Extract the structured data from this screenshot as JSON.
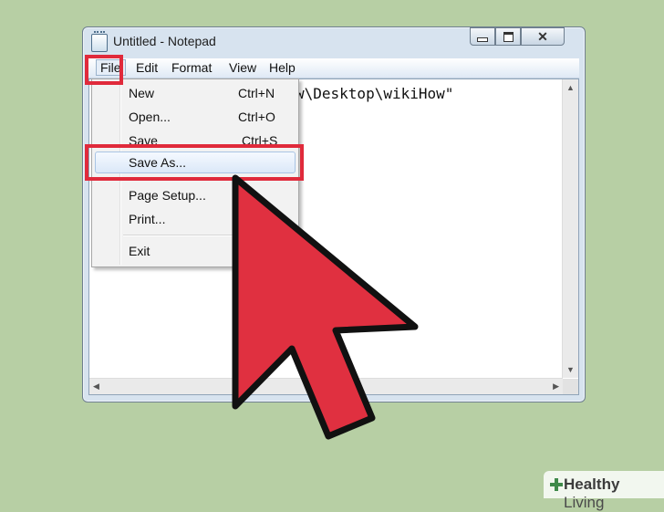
{
  "window": {
    "title": "Untitled - Notepad"
  },
  "menubar": {
    "items": [
      "File",
      "Edit",
      "Format",
      "View",
      "Help"
    ]
  },
  "editor": {
    "text_visible": "w\\Desktop\\wikiHow\""
  },
  "file_menu": {
    "items": [
      {
        "label": "New",
        "shortcut": "Ctrl+N"
      },
      {
        "label": "Open...",
        "shortcut": "Ctrl+O"
      },
      {
        "label": "Save",
        "shortcut": "Ctrl+S"
      },
      {
        "label": "Save As...",
        "shortcut": ""
      },
      {
        "label": "Page Setup...",
        "shortcut": ""
      },
      {
        "label": "Print...",
        "shortcut": ""
      },
      {
        "label": "Exit",
        "shortcut": ""
      }
    ]
  },
  "annotation": {
    "highlight_color": "#e02a3b",
    "cursor_color": "#e03040"
  },
  "watermark": {
    "brand_bold": "Healthy",
    "brand_rest": " Living"
  }
}
